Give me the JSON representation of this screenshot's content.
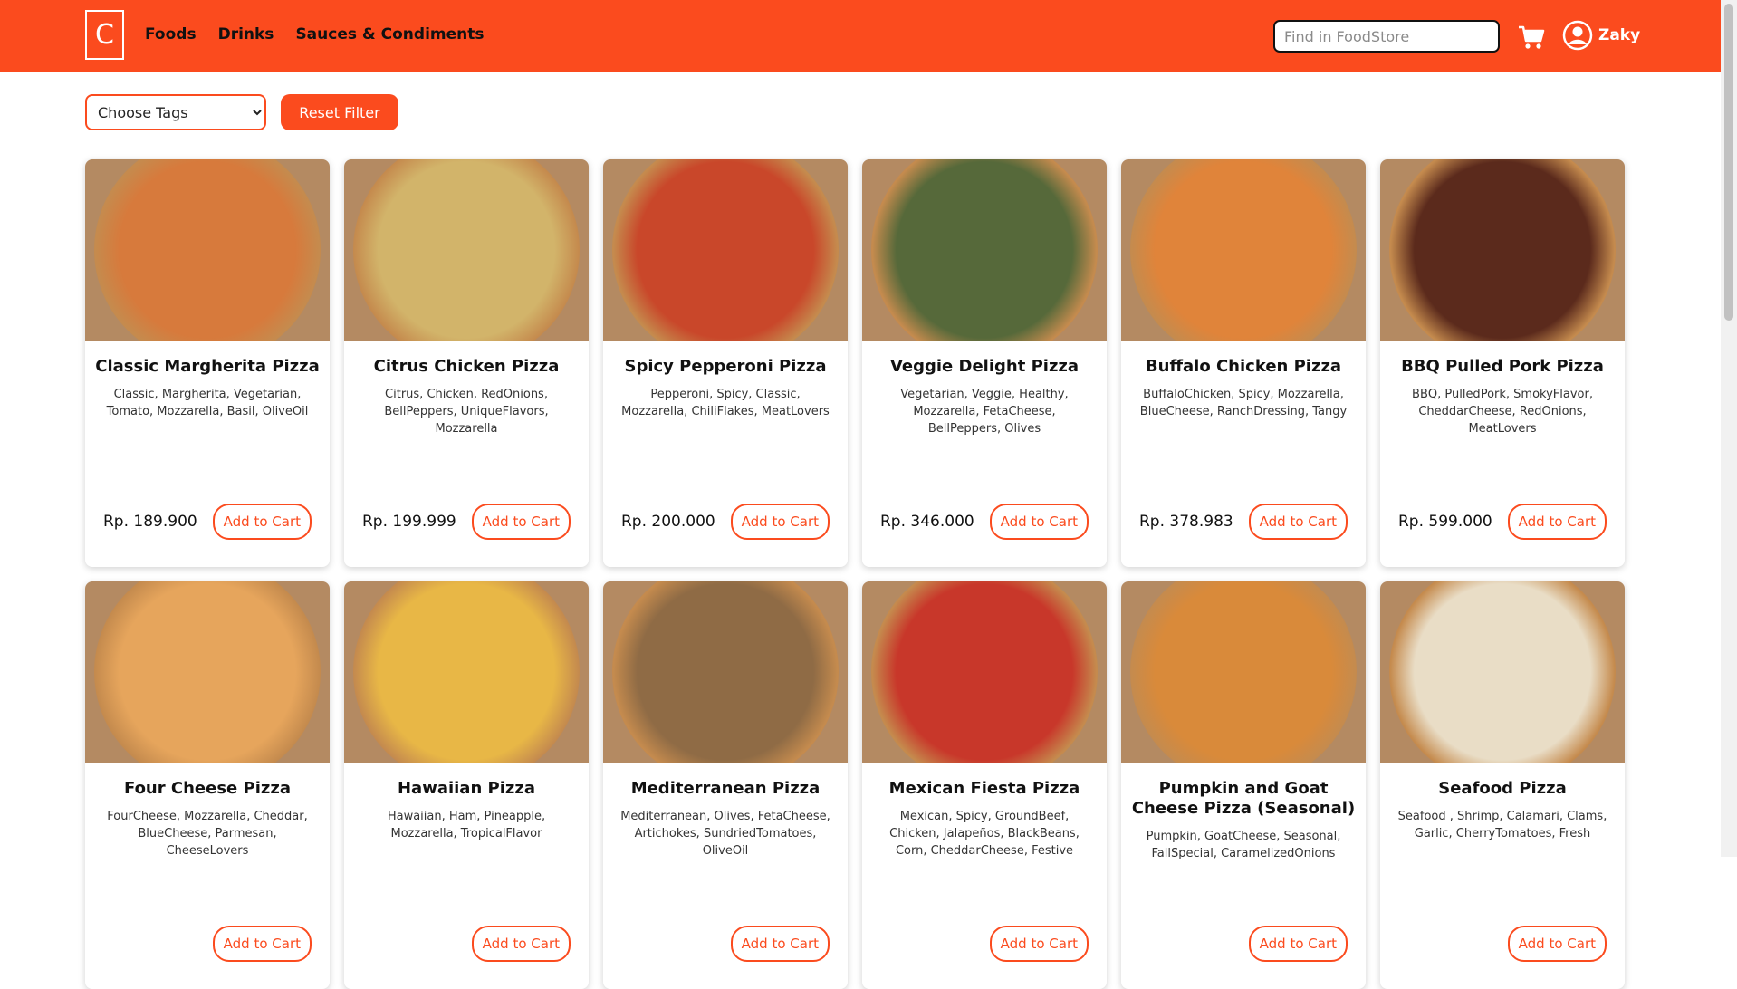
{
  "navbar": {
    "logo": "C",
    "links": [
      "Foods",
      "Drinks",
      "Sauces & Condiments"
    ],
    "search_placeholder": "Find in FoodStore",
    "cart_icon": "cart-icon",
    "user_icon": "user-circle-icon",
    "user_name": "Zaky"
  },
  "filter": {
    "tags_selected": "Choose Tags",
    "reset_label": "Reset Filter"
  },
  "colors": {
    "brand": "#fb4b1e",
    "card_bg": "#ffffff"
  },
  "add_label": "Add to Cart",
  "products": [
    {
      "name": "Classic Margherita Pizza",
      "tags": "Classic, Margherita, Vegetarian, Tomato, Mozzarella, Basil, OliveOil",
      "price": "Rp. 189.900",
      "color": "#d77a3c"
    },
    {
      "name": "Citrus Chicken Pizza",
      "tags": "Citrus, Chicken, RedOnions, BellPeppers, UniqueFlavors, Mozzarella",
      "price": "Rp. 199.999",
      "color": "#d2b46a"
    },
    {
      "name": "Spicy Pepperoni Pizza",
      "tags": "Pepperoni, Spicy, Classic, Mozzarella, ChiliFlakes, MeatLovers",
      "price": "Rp. 200.000",
      "color": "#c9472a"
    },
    {
      "name": "Veggie Delight Pizza",
      "tags": "Vegetarian, Veggie, Healthy, Mozzarella, FetaCheese, BellPeppers, Olives",
      "price": "Rp. 346.000",
      "color": "#56693a"
    },
    {
      "name": "Buffalo Chicken Pizza",
      "tags": "BuffaloChicken, Spicy, Mozzarella, BlueCheese, RanchDressing, Tangy",
      "price": "Rp. 378.983",
      "color": "#e0843a"
    },
    {
      "name": "BBQ Pulled Pork Pizza",
      "tags": "BBQ, PulledPork, SmokyFlavor, CheddarCheese, RedOnions, MeatLovers",
      "price": "Rp. 599.000",
      "color": "#5b2a1c"
    },
    {
      "name": "Four Cheese Pizza",
      "tags": "FourCheese, Mozzarella, Cheddar, BlueCheese, Parmesan, CheeseLovers",
      "price": "",
      "color": "#e6a55c"
    },
    {
      "name": "Hawaiian Pizza",
      "tags": "Hawaiian, Ham, Pineapple, Mozzarella, TropicalFlavor",
      "price": "",
      "color": "#e8b746"
    },
    {
      "name": "Mediterranean Pizza",
      "tags": "Mediterranean, Olives, FetaCheese, Artichokes, SundriedTomatoes, OliveOil",
      "price": "",
      "color": "#8f6b45"
    },
    {
      "name": "Mexican Fiesta Pizza",
      "tags": "Mexican, Spicy, GroundBeef, Chicken, Jalapeños, BlackBeans, Corn, CheddarCheese, Festive",
      "price": "",
      "color": "#c8372a"
    },
    {
      "name": "Pumpkin and Goat Cheese Pizza (Seasonal)",
      "tags": "Pumpkin, GoatCheese, Seasonal, FallSpecial, CaramelizedOnions",
      "price": "",
      "color": "#d98a3a"
    },
    {
      "name": "Seafood Pizza",
      "tags": "Seafood , Shrimp, Calamari, Clams, Garlic, CherryTomatoes, Fresh",
      "price": "",
      "color": "#e9ddc6"
    }
  ]
}
